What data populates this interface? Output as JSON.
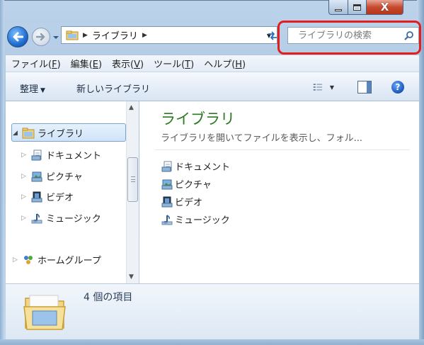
{
  "window": {
    "caption_buttons": {
      "minimize": "minimize-icon",
      "maximize": "maximize-icon",
      "close_label": "X"
    }
  },
  "nav": {
    "breadcrumb": [
      "ライブラリ"
    ],
    "search": {
      "placeholder": "ライブラリの検索"
    },
    "icons": {
      "back": "back-arrow-icon",
      "forward": "forward-arrow-icon",
      "refresh": "refresh-icon",
      "search": "search-icon"
    }
  },
  "menu": {
    "items": [
      {
        "label": "ファイル(",
        "key": "F",
        "tail": ")"
      },
      {
        "label": "編集(",
        "key": "E",
        "tail": ")"
      },
      {
        "label": "表示(",
        "key": "V",
        "tail": ")"
      },
      {
        "label": "ツール(",
        "key": "T",
        "tail": ")"
      },
      {
        "label": "ヘルプ(",
        "key": "H",
        "tail": ")"
      }
    ]
  },
  "toolbar": {
    "organize": "整理",
    "new_library": "新しいライブラリ",
    "help": "?"
  },
  "sidebar": {
    "items": [
      {
        "label": "ライブラリ",
        "icon": "library-icon",
        "expanded": true,
        "selected": true
      },
      {
        "label": "ドキュメント",
        "icon": "documents-icon"
      },
      {
        "label": "ピクチャ",
        "icon": "pictures-icon"
      },
      {
        "label": "ビデオ",
        "icon": "videos-icon"
      },
      {
        "label": "ミュージック",
        "icon": "music-icon"
      },
      {
        "label": "ホームグループ",
        "icon": "homegroup-icon"
      }
    ]
  },
  "main": {
    "title": "ライブラリ",
    "description": "ライブラリを開いてファイルを表示し、フォル...",
    "items": [
      {
        "label": "ドキュメント",
        "icon": "documents-icon"
      },
      {
        "label": "ピクチャ",
        "icon": "pictures-icon"
      },
      {
        "label": "ビデオ",
        "icon": "videos-icon"
      },
      {
        "label": "ミュージック",
        "icon": "music-icon"
      }
    ]
  },
  "details": {
    "count_text": "4 個の項目"
  },
  "colors": {
    "title_green": "#2a7a1f",
    "highlight_red": "#e11d1d",
    "close_red": "#c74a30"
  }
}
